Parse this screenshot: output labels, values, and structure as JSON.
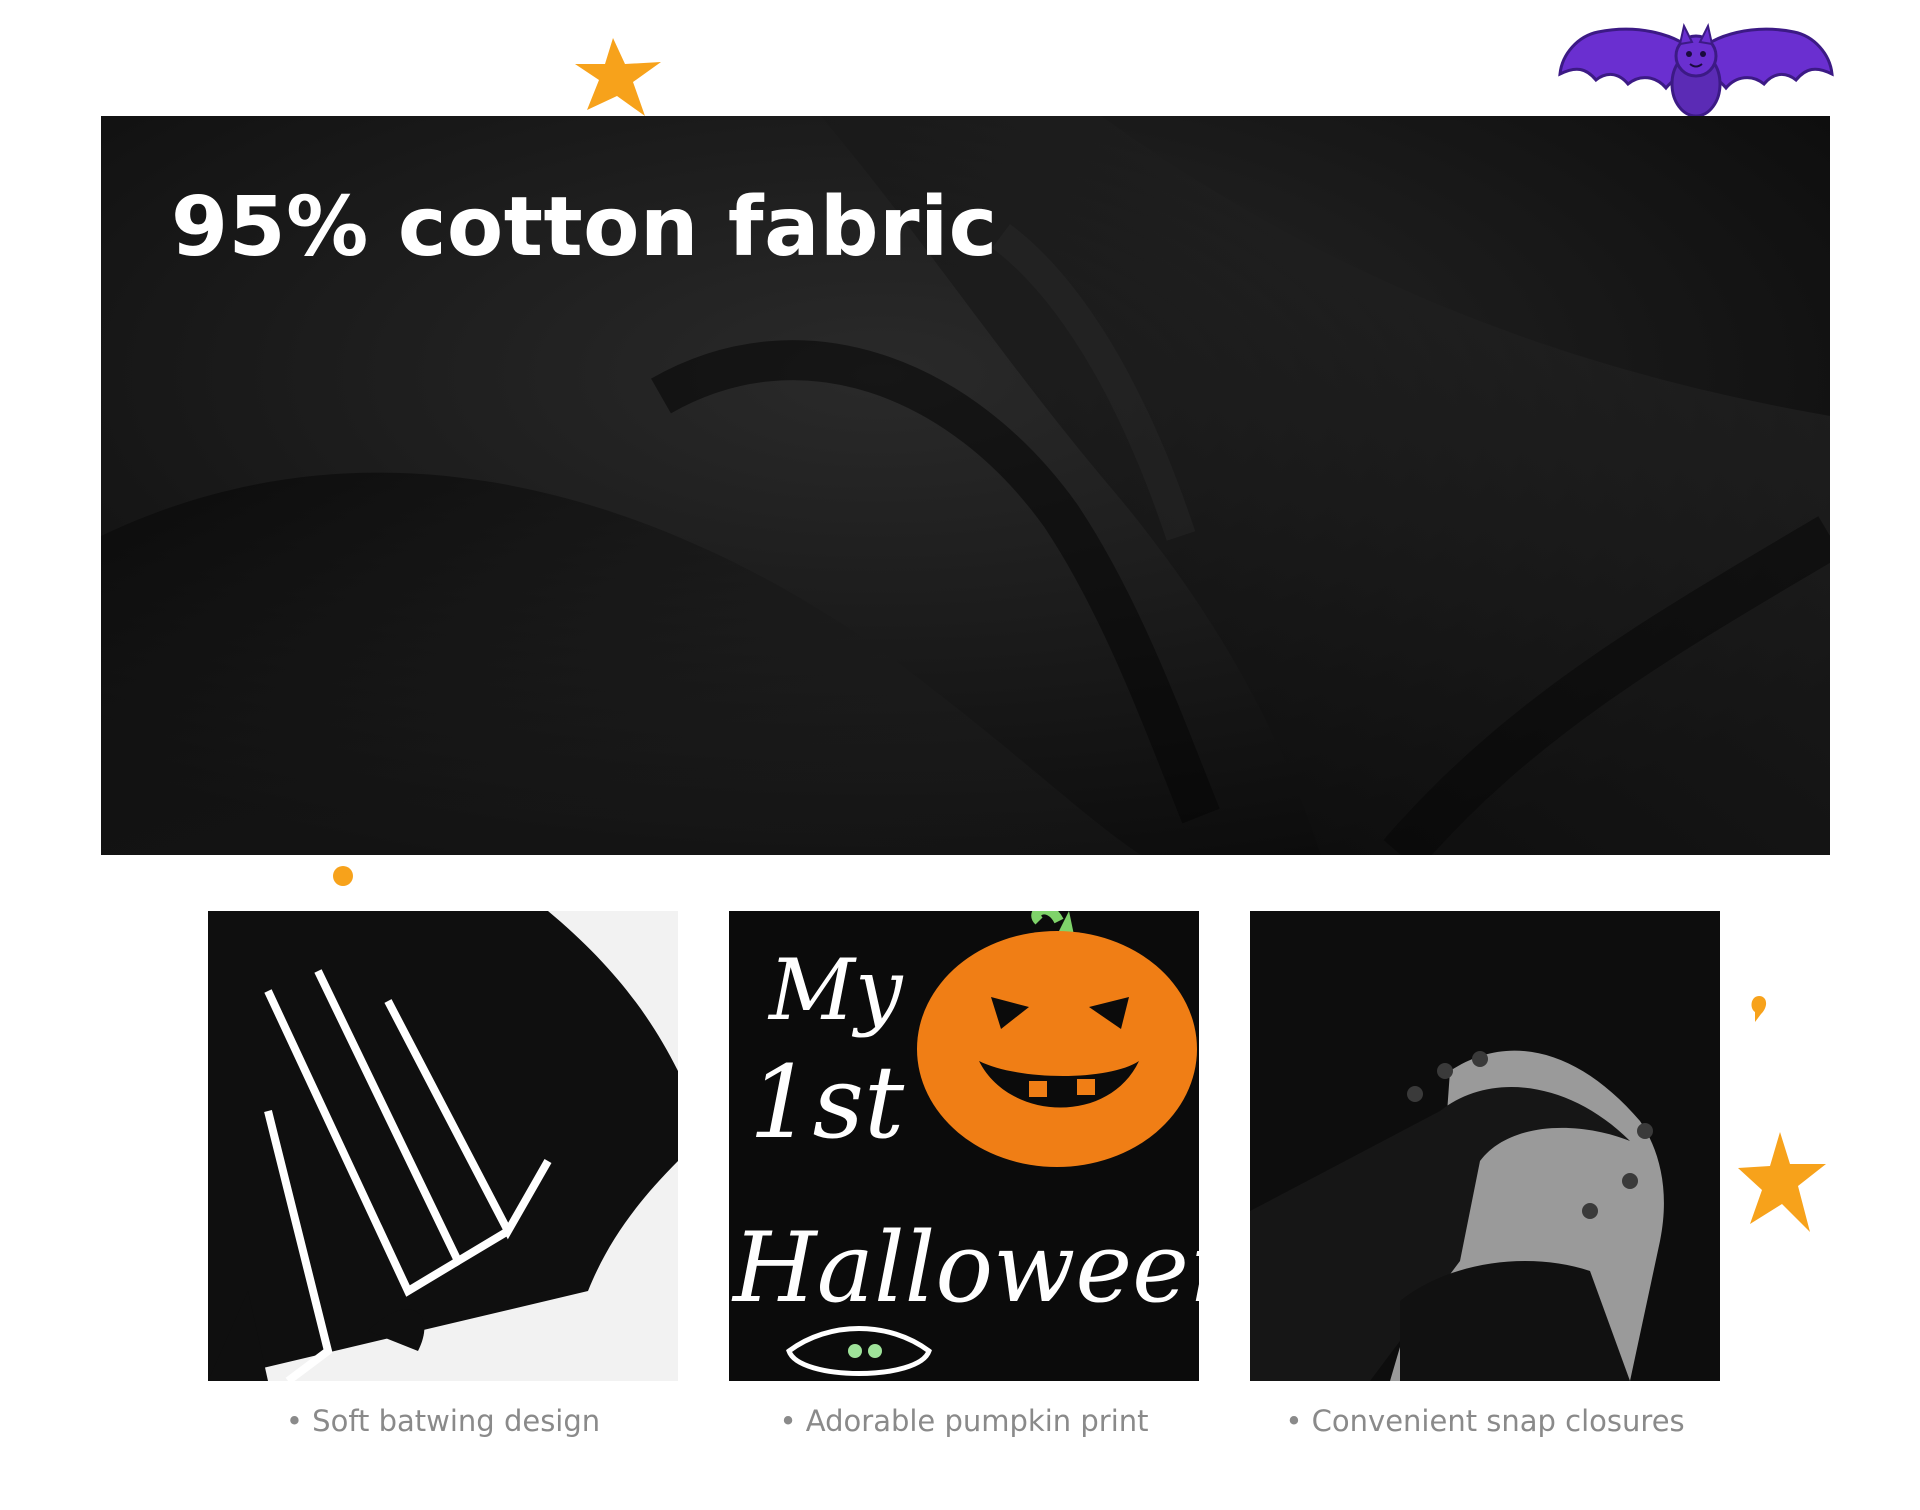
{
  "hero": {
    "title": "95% cotton fabric"
  },
  "features": [
    {
      "image_icon": "bat-wing-sleeve-photo",
      "caption": "• Soft batwing design"
    },
    {
      "image_icon": "pumpkin-print-photo",
      "caption": "• Adorable pumpkin print"
    },
    {
      "image_icon": "snap-closure-photo",
      "caption": "• Convenient snap closures"
    }
  ],
  "pumpkin_print": {
    "line1": "My",
    "line2": "1st",
    "line3": "Halloween"
  },
  "colors": {
    "accent_orange": "#F7A21B",
    "bat_purple": "#5B2BB5",
    "fabric_black": "#141414",
    "pumpkin_orange": "#F07E15",
    "caption_gray": "#8a8a8a"
  }
}
